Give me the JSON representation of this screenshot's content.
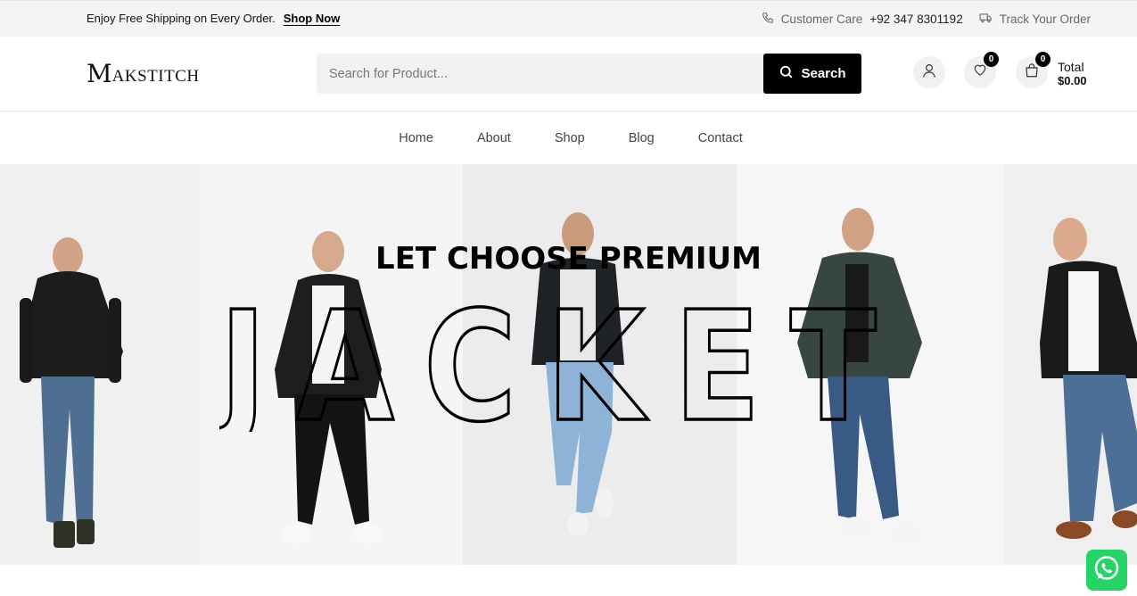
{
  "topbar": {
    "promo_text": "Enjoy Free Shipping on Every Order.",
    "promo_link": "Shop Now",
    "customer_care_label": "Customer Care",
    "phone": "+92 347 8301192",
    "track_label": "Track Your Order"
  },
  "header": {
    "logo_mark": "M",
    "logo_text": "AKSTITCH",
    "search_placeholder": "Search for Product...",
    "search_button": "Search",
    "wishlist_count": "0",
    "cart_count": "0",
    "total_label": "Total",
    "total_amount": "$0.00"
  },
  "nav": {
    "items": [
      "Home",
      "About",
      "Shop",
      "Blog",
      "Contact"
    ]
  },
  "hero": {
    "subtitle": "LET CHOOSE PREMIUM",
    "title": "JACKET"
  },
  "icons": {
    "phone": "phone-icon",
    "truck": "truck-icon",
    "search": "search-icon",
    "user": "user-icon",
    "heart": "heart-icon",
    "bag": "shopping-bag-icon",
    "whatsapp": "whatsapp-icon"
  },
  "colors": {
    "accent": "#000000",
    "topbar_bg": "#f4f4f4",
    "whatsapp": "#25d366"
  }
}
